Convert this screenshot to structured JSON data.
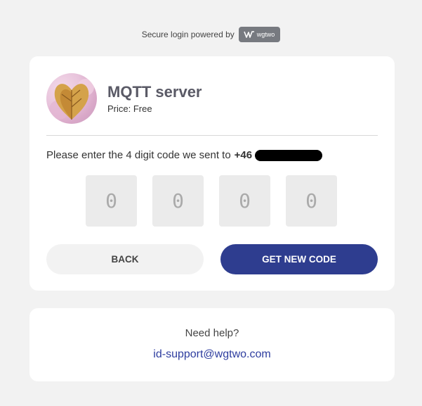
{
  "header": {
    "powered_label": "Secure login powered by",
    "brand_name": "wgtwo"
  },
  "app": {
    "title": "MQTT server",
    "price": "Price: Free"
  },
  "verification": {
    "prompt": "Please enter the 4 digit code we sent to",
    "phone_prefix": "+46",
    "digits": [
      {
        "placeholder": "0",
        "value": ""
      },
      {
        "placeholder": "0",
        "value": ""
      },
      {
        "placeholder": "0",
        "value": ""
      },
      {
        "placeholder": "0",
        "value": ""
      }
    ]
  },
  "actions": {
    "back_label": "BACK",
    "new_code_label": "GET NEW CODE"
  },
  "help": {
    "question": "Need help?",
    "email": "id-support@wgtwo.com"
  },
  "colors": {
    "background": "#f2f2f2",
    "primary": "#2e3d8f",
    "link": "#2e3d9f",
    "badge": "#777a80"
  }
}
